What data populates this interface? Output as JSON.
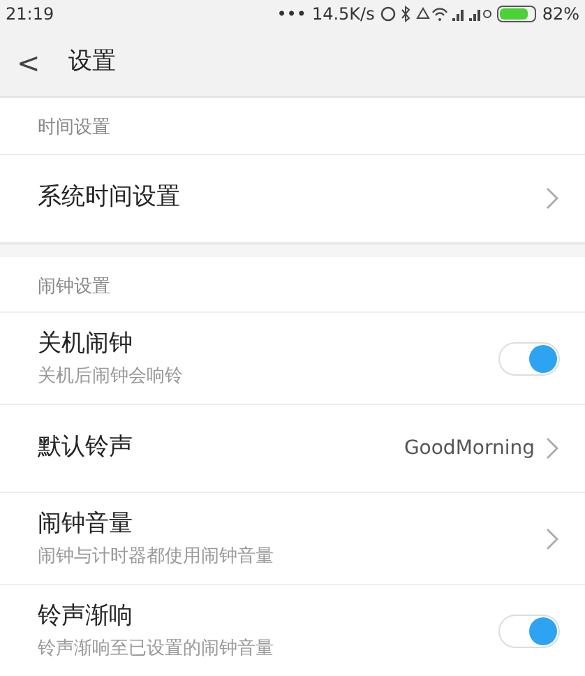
{
  "status_bar": {
    "time": "21:19",
    "dots": "•••",
    "speed": "14.5K/s",
    "battery": "82%"
  },
  "header": {
    "back": "<",
    "title": "设置"
  },
  "sections": [
    {
      "title": "时间设置",
      "rows": [
        {
          "kind": "link",
          "title": "系统时间设置"
        }
      ]
    },
    {
      "title": "闹钟设置",
      "rows": [
        {
          "kind": "switch",
          "title": "关机闹钟",
          "subtitle": "关机后闹钟会响铃",
          "on": true
        },
        {
          "kind": "link",
          "title": "默认铃声",
          "value": "GoodMorning"
        },
        {
          "kind": "link",
          "title": "闹钟音量",
          "subtitle": "闹钟与计时器都使用闹钟音量"
        },
        {
          "kind": "switch",
          "title": "铃声渐响",
          "subtitle": "铃声渐响至已设置的闹钟音量",
          "on": true
        }
      ]
    }
  ]
}
